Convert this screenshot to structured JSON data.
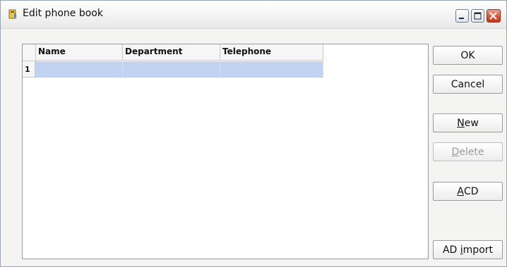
{
  "window": {
    "title": "Edit phone book"
  },
  "grid": {
    "columns": [
      "Name",
      "Department",
      "Telephone"
    ],
    "rows": [
      {
        "number": "1",
        "cells": [
          "",
          "",
          ""
        ]
      }
    ]
  },
  "buttons": {
    "ok": {
      "label": "OK"
    },
    "cancel": {
      "label": "Cancel"
    },
    "new": {
      "mnemonic": "N",
      "rest": "ew"
    },
    "delete": {
      "mnemonic": "D",
      "rest": "elete",
      "enabled": false
    },
    "acd": {
      "mnemonic": "A",
      "rest": "CD"
    },
    "ad_import": {
      "pre": "AD ",
      "mnemonic": "i",
      "rest": "mport"
    }
  },
  "colors": {
    "selected_row": "#c1d3f0",
    "close_button": "#d8502f"
  }
}
